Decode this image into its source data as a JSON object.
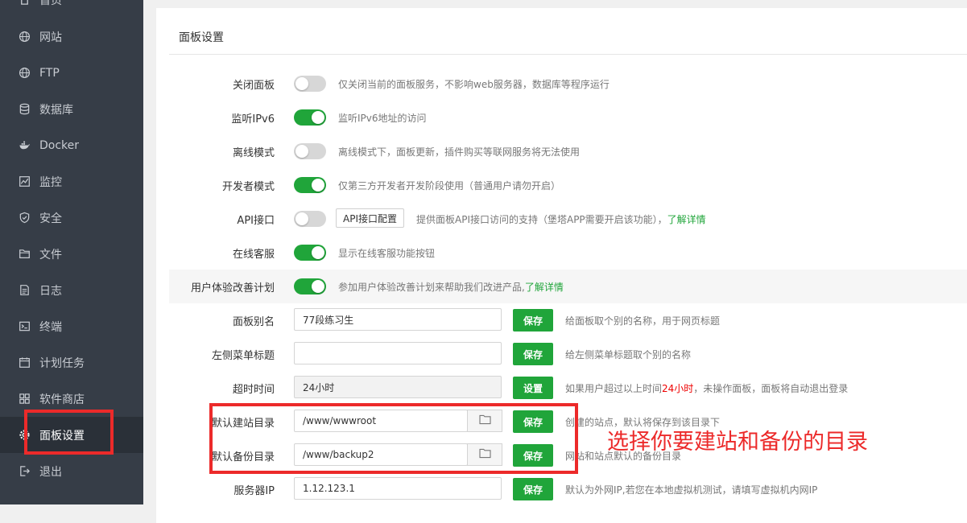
{
  "sidebar": {
    "items": [
      {
        "label": "首页",
        "icon": "home-icon"
      },
      {
        "label": "网站",
        "icon": "globe-icon"
      },
      {
        "label": "FTP",
        "icon": "globe-icon"
      },
      {
        "label": "数据库",
        "icon": "database-icon"
      },
      {
        "label": "Docker",
        "icon": "docker-icon"
      },
      {
        "label": "监控",
        "icon": "monitor-icon"
      },
      {
        "label": "安全",
        "icon": "shield-icon"
      },
      {
        "label": "文件",
        "icon": "folder-icon"
      },
      {
        "label": "日志",
        "icon": "log-icon"
      },
      {
        "label": "终端",
        "icon": "terminal-icon"
      },
      {
        "label": "计划任务",
        "icon": "calendar-icon"
      },
      {
        "label": "软件商店",
        "icon": "grid-icon"
      },
      {
        "label": "面板设置",
        "icon": "gear-icon",
        "active": true
      },
      {
        "label": "退出",
        "icon": "logout-icon"
      }
    ]
  },
  "panel": {
    "title": "面板设置",
    "toggles": [
      {
        "label": "关闭面板",
        "on": false,
        "desc": "仅关闭当前的面板服务，不影响web服务器，数据库等程序运行"
      },
      {
        "label": "监听IPv6",
        "on": true,
        "desc": "监听IPv6地址的访问"
      },
      {
        "label": "离线模式",
        "on": false,
        "desc": "离线模式下，面板更新，插件购买等联网服务将无法使用"
      },
      {
        "label": "开发者模式",
        "on": true,
        "desc": "仅第三方开发者开发阶段使用（普通用户请勿开启）"
      },
      {
        "label": "API接口",
        "on": false,
        "button": "API接口配置",
        "desc": "提供面板API接口访问的支持（堡塔APP需要开启该功能），",
        "link": "了解详情"
      },
      {
        "label": "在线客服",
        "on": true,
        "desc": "显示在线客服功能按钮"
      },
      {
        "label": "用户体验改善计划",
        "on": true,
        "desc": "参加用户体验改善计划来帮助我们改进产品,",
        "link": "了解详情"
      }
    ],
    "fields": [
      {
        "label": "面板别名",
        "value": "77段练习生",
        "button": "保存",
        "desc": "给面板取个别的名称，用于网页标题"
      },
      {
        "label": "左侧菜单标题",
        "value": "",
        "button": "保存",
        "desc": "给左侧菜单标题取个别的名称"
      },
      {
        "label": "超时时间",
        "value": "24小时",
        "button": "设置",
        "desc_pre": "如果用户超过以上时间",
        "desc_red": "24小时",
        "desc_post": "，未操作面板，面板将自动退出登录"
      },
      {
        "label": "默认建站目录",
        "value": "/www/wwwroot",
        "button": "保存",
        "desc": "创建的站点，默认将保存到该目录下"
      },
      {
        "label": "默认备份目录",
        "value": "/www/backup2",
        "button": "保存",
        "desc": "网站和站点默认的备份目录"
      },
      {
        "label": "服务器IP",
        "value": "1.12.123.1",
        "button": "保存",
        "desc": "默认为外网IP,若您在本地虚拟机测试，请填写虚拟机内网IP"
      }
    ]
  },
  "annotation": {
    "text": "选择你要建站和备份的目录",
    "color": "#ec2a2a"
  },
  "colors": {
    "sidebar_bg": "#363d47",
    "accent_green": "#20a53a",
    "highlight_red": "#ec2a2a"
  }
}
